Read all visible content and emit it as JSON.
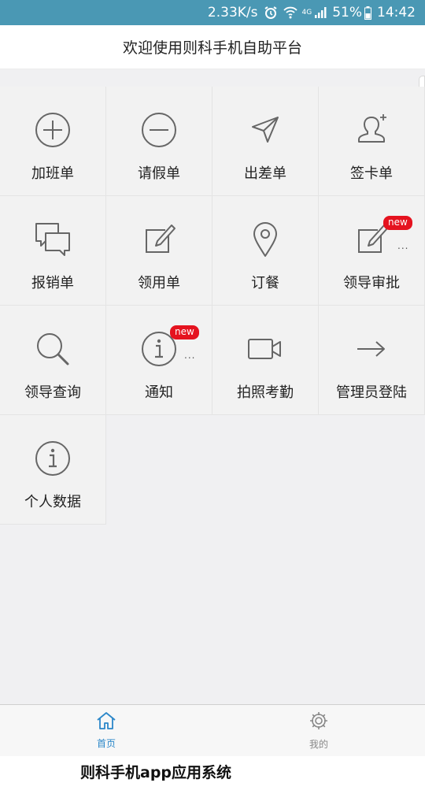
{
  "status_bar": {
    "speed": "2.33K/s",
    "network": "4G",
    "battery": "51%",
    "time": "14:42"
  },
  "header": {
    "title": "欢迎使用则科手机自助平台"
  },
  "grid": {
    "items": [
      {
        "label": "加班单",
        "icon": "plus-circle-icon"
      },
      {
        "label": "请假单",
        "icon": "minus-circle-icon"
      },
      {
        "label": "出差单",
        "icon": "paper-plane-icon"
      },
      {
        "label": "签卡单",
        "icon": "user-add-icon"
      },
      {
        "label": "报销单",
        "icon": "chat-bubbles-icon"
      },
      {
        "label": "领用单",
        "icon": "edit-icon"
      },
      {
        "label": "订餐",
        "icon": "map-pin-icon"
      },
      {
        "label": "领导审批",
        "icon": "edit-icon",
        "badge": "new",
        "dots": "..."
      },
      {
        "label": "领导查询",
        "icon": "search-icon"
      },
      {
        "label": "通知",
        "icon": "info-circle-icon",
        "badge": "new",
        "dots": "..."
      },
      {
        "label": "拍照考勤",
        "icon": "video-camera-icon"
      },
      {
        "label": "管理员登陆",
        "icon": "arrow-right-icon"
      },
      {
        "label": "个人数据",
        "icon": "info-circle-icon"
      }
    ]
  },
  "tabbar": {
    "home_label": "首页",
    "mine_label": "我的",
    "active_color": "#2b87c9"
  },
  "caption": "则科手机app应用系统"
}
